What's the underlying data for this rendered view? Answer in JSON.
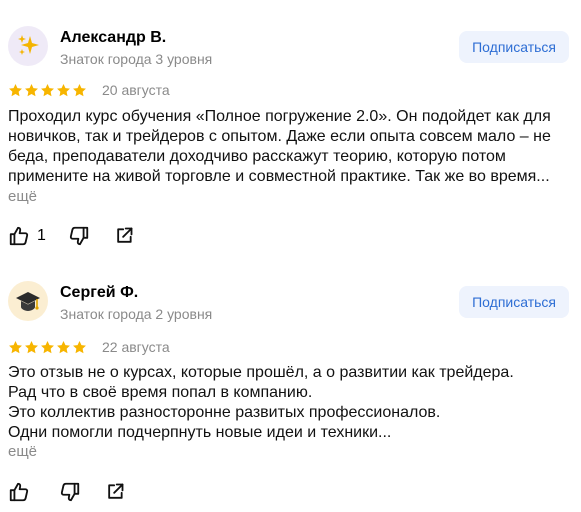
{
  "reviews": [
    {
      "author": "Александр В.",
      "level": "Знаток города 3 уровня",
      "avatar_icon": "sparkles-icon",
      "subscribe_label": "Подписаться",
      "rating": 5,
      "date": "20 августа",
      "text": "Проходил курс обучения «Полное погружение 2.0». Он подойдет как для новичков, так и трейдеров с опытом. Даже если опыта совсем мало – не беда, преподаватели доходчиво расскажут теорию, которую потом примените на живой торговле и совместной практике. Так же во время...",
      "more_label": "ещё",
      "likes": "1"
    },
    {
      "author": "Сергей Ф.",
      "level": "Знаток города 2 уровня",
      "avatar_icon": "graduation-cap-icon",
      "subscribe_label": "Подписаться",
      "rating": 5,
      "date": "22 августа",
      "text": "Это отзыв не о курсах, которые прошёл, а о развитии как трейдера.\nРад что в своё время попал в компанию.\nЭто коллектив разносторонне развитых профессионалов.\nОдни помогли подчерпнуть новые идеи и техники...",
      "more_label": "ещё",
      "likes": ""
    }
  ],
  "colors": {
    "star": "#f7b500",
    "accent": "#2e6ed4",
    "muted": "#8a8a8a",
    "subscribe_bg": "#eef3fd"
  }
}
